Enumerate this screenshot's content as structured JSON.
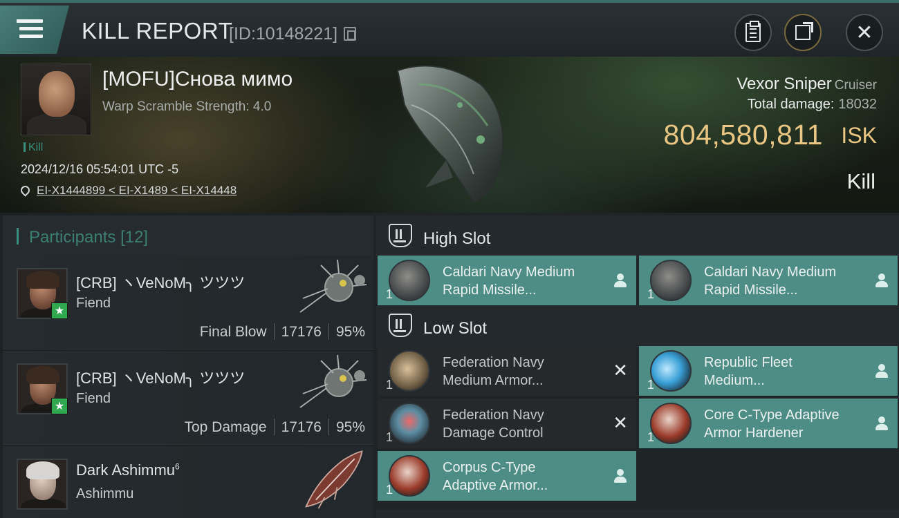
{
  "header": {
    "title": "KILL REPORT",
    "report_id": "[ID:10148221]"
  },
  "victim": {
    "pilot": "[MOFU]Снова мимо",
    "warp_scramble": "Warp Scramble Strength: 4.0",
    "tag": "Kill",
    "datetime": "2024/12/16 05:54:01 UTC -5",
    "location": "EI-X1444899 < EI-X1489 < EI-X14448",
    "ship": "Vexor Sniper",
    "ship_class": "Cruiser",
    "total_damage_label": "Total damage:",
    "total_damage": "18032",
    "isk_value": "804,580,811",
    "isk_unit": "ISK",
    "result": "Kill"
  },
  "participants": {
    "label": "Participants",
    "count": "[12]",
    "rows": [
      {
        "name": "[CRB] ヽVeNoM╮ ツツツ",
        "ship": "Fiend",
        "role": "Final Blow",
        "damage": "17176",
        "percent": "95%"
      },
      {
        "name": "[CRB] ヽVeNoM╮ ツツツ",
        "ship": "Fiend",
        "role": "Top Damage",
        "damage": "17176",
        "percent": "95%"
      },
      {
        "name": "Dark Ashimmu",
        "sup": "6",
        "ship": "Ashimmu"
      }
    ]
  },
  "fitting": {
    "high_slot": {
      "label": "High Slot",
      "modules": [
        {
          "name_line1": "Caldari Navy Medium",
          "name_line2": "Rapid Missile...",
          "qty": "1",
          "status": "dropped"
        },
        {
          "name_line1": "Caldari Navy Medium",
          "name_line2": "Rapid Missile...",
          "qty": "1",
          "status": "dropped"
        }
      ]
    },
    "low_slot": {
      "label": "Low Slot",
      "modules": [
        {
          "name_line1": "Federation Navy",
          "name_line2": "Medium Armor...",
          "qty": "1",
          "status": "destroyed"
        },
        {
          "name_line1": "Republic Fleet",
          "name_line2": "Medium...",
          "qty": "1",
          "status": "dropped"
        },
        {
          "name_line1": "Federation Navy",
          "name_line2": "Damage Control",
          "qty": "1",
          "status": "destroyed"
        },
        {
          "name_line1": "Core C-Type Adaptive",
          "name_line2": " Armor Hardener",
          "qty": "1",
          "status": "dropped"
        },
        {
          "name_line1": "Corpus C-Type",
          "name_line2": "Adaptive Armor...",
          "qty": "1",
          "status": "dropped"
        }
      ]
    }
  },
  "colors": {
    "accent": "#3a8f7e",
    "isk": "#e9c683",
    "dropped_module": "#4e8d85",
    "destroyed_module": "#25292b"
  }
}
